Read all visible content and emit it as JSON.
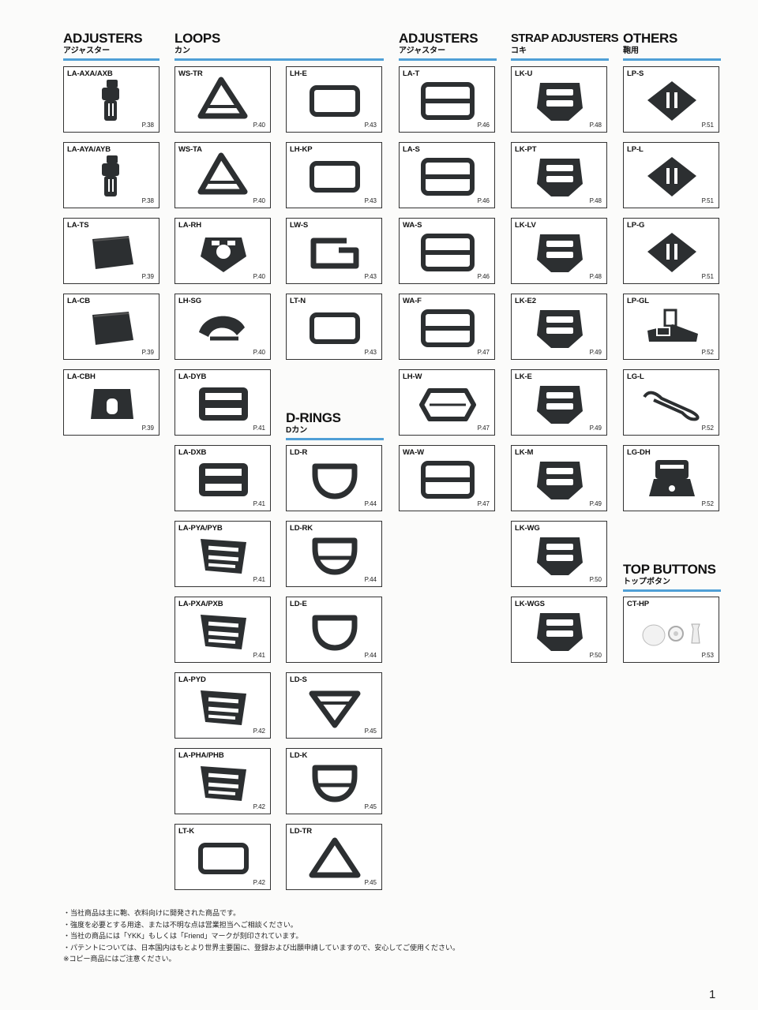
{
  "sections": [
    {
      "title": "ADJUSTERS",
      "sub": "アジャスター"
    },
    {
      "title": "LOOPS",
      "sub": "カン"
    },
    {
      "title": "D-RINGS",
      "sub": "Dカン"
    },
    {
      "title": "ADJUSTERS",
      "sub": "アジャスター"
    },
    {
      "title": "STRAP ADJUSTERS",
      "sub": "コキ"
    },
    {
      "title": "OTHERS",
      "sub": "鞄用"
    },
    {
      "title": "TOP BUTTONS",
      "sub": "トップボタン"
    }
  ],
  "products": [
    {
      "code": "LA-AXA/AXB",
      "page": "P.38",
      "icon": "buckle-clip"
    },
    {
      "code": "LA-AYA/AYB",
      "page": "P.38",
      "icon": "buckle-clip"
    },
    {
      "code": "LA-TS",
      "page": "P.39",
      "icon": "strap-tip"
    },
    {
      "code": "LA-CB",
      "page": "P.39",
      "icon": "strap-tip"
    },
    {
      "code": "LA-CBH",
      "page": "P.39",
      "icon": "strap-tip-hole"
    },
    {
      "code": "WS-TR",
      "page": "P.40",
      "icon": "triangle-loop"
    },
    {
      "code": "WS-TA",
      "page": "P.40",
      "icon": "triangle-loop"
    },
    {
      "code": "LA-RH",
      "page": "P.40",
      "icon": "three-way-ring"
    },
    {
      "code": "LH-SG",
      "page": "P.40",
      "icon": "hook"
    },
    {
      "code": "LA-DYB",
      "page": "P.41",
      "icon": "slide-adjuster"
    },
    {
      "code": "LA-DXB",
      "page": "P.41",
      "icon": "slide-adjuster"
    },
    {
      "code": "LA-PYA/PYB",
      "page": "P.41",
      "icon": "ladder-adjuster"
    },
    {
      "code": "LA-PXA/PXB",
      "page": "P.41",
      "icon": "ladder-adjuster"
    },
    {
      "code": "LA-PYD",
      "page": "P.42",
      "icon": "ladder-adjuster"
    },
    {
      "code": "LA-PHA/PHB",
      "page": "P.42",
      "icon": "ladder-adjuster"
    },
    {
      "code": "LT-K",
      "page": "P.42",
      "icon": "rect-loop"
    },
    {
      "code": "LH-E",
      "page": "P.43",
      "icon": "rect-loop"
    },
    {
      "code": "LH-KP",
      "page": "P.43",
      "icon": "rect-loop"
    },
    {
      "code": "LW-S",
      "page": "P.43",
      "icon": "open-loop"
    },
    {
      "code": "LT-N",
      "page": "P.43",
      "icon": "rect-loop"
    },
    {
      "code": "LD-R",
      "page": "P.44",
      "icon": "d-ring"
    },
    {
      "code": "LD-RK",
      "page": "P.44",
      "icon": "d-ring-bar"
    },
    {
      "code": "LD-E",
      "page": "P.44",
      "icon": "d-ring"
    },
    {
      "code": "LD-S",
      "page": "P.45",
      "icon": "triangle-ring-bar"
    },
    {
      "code": "LD-K",
      "page": "P.45",
      "icon": "d-ring-bar"
    },
    {
      "code": "LD-TR",
      "page": "P.45",
      "icon": "triangle-ring"
    },
    {
      "code": "LA-T",
      "page": "P.46",
      "icon": "tri-glide"
    },
    {
      "code": "LA-S",
      "page": "P.46",
      "icon": "tri-glide"
    },
    {
      "code": "WA-S",
      "page": "P.46",
      "icon": "tri-glide"
    },
    {
      "code": "WA-F",
      "page": "P.47",
      "icon": "tri-glide"
    },
    {
      "code": "LH-W",
      "page": "P.47",
      "icon": "oval-glide"
    },
    {
      "code": "WA-W",
      "page": "P.47",
      "icon": "tri-glide"
    },
    {
      "code": "LK-U",
      "page": "P.48",
      "icon": "ladder-lock"
    },
    {
      "code": "LK-PT",
      "page": "P.48",
      "icon": "ladder-lock"
    },
    {
      "code": "LK-LV",
      "page": "P.48",
      "icon": "ladder-lock"
    },
    {
      "code": "LK-E2",
      "page": "P.49",
      "icon": "ladder-lock"
    },
    {
      "code": "LK-E",
      "page": "P.49",
      "icon": "ladder-lock"
    },
    {
      "code": "LK-M",
      "page": "P.49",
      "icon": "ladder-lock"
    },
    {
      "code": "LK-WG",
      "page": "P.50",
      "icon": "ladder-lock"
    },
    {
      "code": "LK-WGS",
      "page": "P.50",
      "icon": "ladder-lock"
    },
    {
      "code": "LP-S",
      "page": "P.51",
      "icon": "slot-plate"
    },
    {
      "code": "LP-L",
      "page": "P.51",
      "icon": "slot-plate"
    },
    {
      "code": "LP-G",
      "page": "P.51",
      "icon": "slot-plate"
    },
    {
      "code": "LP-GL",
      "page": "P.52",
      "icon": "hinge-plate"
    },
    {
      "code": "LG-L",
      "page": "P.52",
      "icon": "cord-loop"
    },
    {
      "code": "LG-DH",
      "page": "P.52",
      "icon": "plate-adjuster"
    },
    {
      "code": "CT-HP",
      "page": "P.53",
      "icon": "buttons"
    }
  ],
  "notes": [
    "・当社商品は主に鞄、衣料向けに開発された商品です。",
    "・強度を必要とする用途、または不明な点は営業担当へご相談ください。",
    "・当社の商品には「YKK」もしくは「Friend」マークが刻印されています。",
    "・パテントについては、日本国内はもとより世界主要国に、登録および出願申請していますので、安心してご使用ください。",
    "※コピー商品にはご注意ください。"
  ],
  "page_number": "1",
  "colors": {
    "rule": "#4f9fd6",
    "part": "#2c2f31"
  }
}
